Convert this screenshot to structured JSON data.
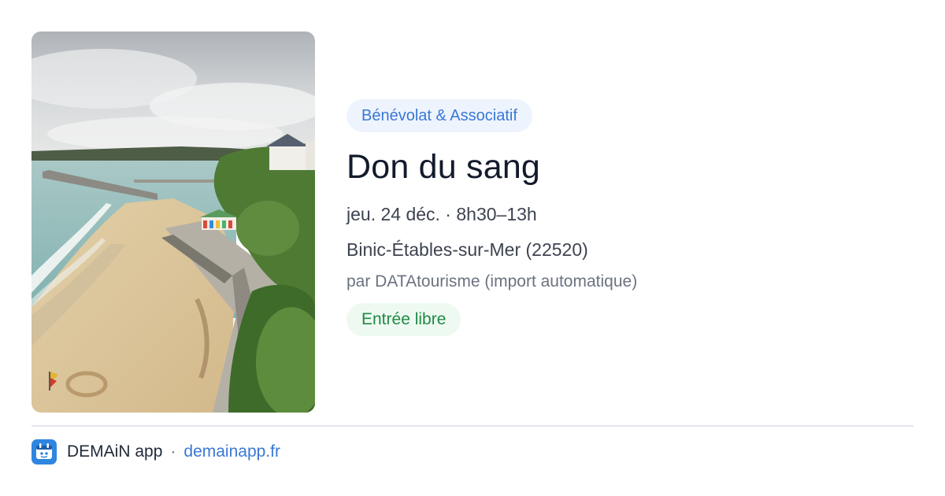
{
  "card": {
    "image_alt": "coastal-beach-photo",
    "category": "Bénévolat & Associatif",
    "title": "Don du sang",
    "when": "jeu. 24 déc. · 8h30–13h",
    "place": "Binic-Étables-sur-Mer (22520)",
    "source": "par DATAtourisme (import automatique)",
    "price": "Entrée libre"
  },
  "footer": {
    "app_name": "DEMAiN app",
    "separator": "·",
    "link": "demainapp.fr",
    "icon": "demain-app-icon"
  },
  "colors": {
    "accent_blue": "#3a78d4",
    "category_bg": "#eef4fd",
    "free_green": "#1f8a45",
    "free_bg": "#eefaf1",
    "divider": "#e3e8ee"
  }
}
